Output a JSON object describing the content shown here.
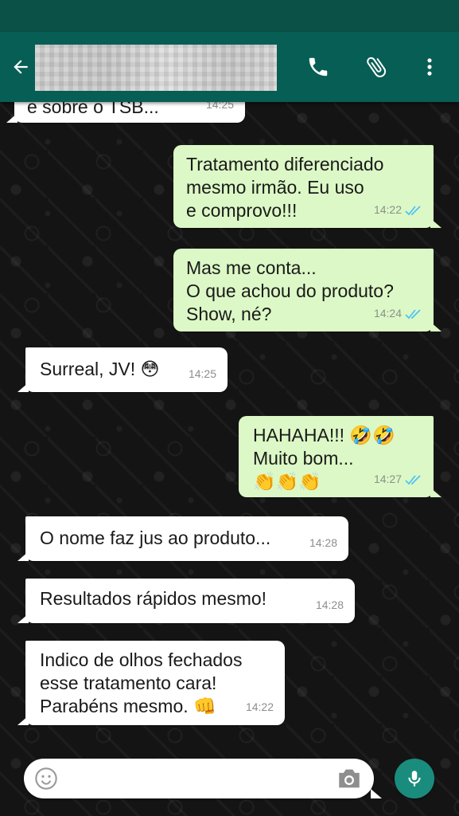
{
  "header": {
    "contact_name": "██████ █████ █████",
    "back_icon": "arrow-left-icon",
    "call_icon": "phone-icon",
    "attach_icon": "paperclip-icon",
    "menu_icon": "more-vertical-icon",
    "colors": {
      "bar": "#075e54",
      "status": "#0b5148"
    }
  },
  "messages": [
    {
      "dir": "in",
      "text": "e sobre o TSB...",
      "time": "14:25"
    },
    {
      "dir": "out",
      "text": "Tratamento diferenciado\nmesmo irmão. Eu uso\ne comprovo!!!",
      "time": "14:22",
      "read": true
    },
    {
      "dir": "out",
      "text": "Mas me conta...\nO que achou do produto?\nShow, né?",
      "time": "14:24",
      "read": true
    },
    {
      "dir": "in",
      "text": "Surreal, JV! 😳",
      "time": "14:25"
    },
    {
      "dir": "out",
      "text": "HAHAHA!!! 🤣🤣\nMuito bom...\n👏👏👏",
      "time": "14:27",
      "read": true
    },
    {
      "dir": "in",
      "text": "O nome faz jus ao produto...",
      "time": "14:28"
    },
    {
      "dir": "in",
      "text": "Resultados rápidos mesmo!",
      "time": "14:28"
    },
    {
      "dir": "in",
      "text": "Indico de olhos fechados\nesse tratamento cara!\nParabéns mesmo. 👊",
      "time": "14:22"
    }
  ],
  "composer": {
    "placeholder": "",
    "emoji_icon": "smiley-icon",
    "camera_icon": "camera-icon",
    "mic_icon": "microphone-icon"
  },
  "colors": {
    "incoming": "#ffffff",
    "outgoing": "#dcf8c6",
    "read_check": "#4fc3f7",
    "mic": "#1a8c7d"
  }
}
